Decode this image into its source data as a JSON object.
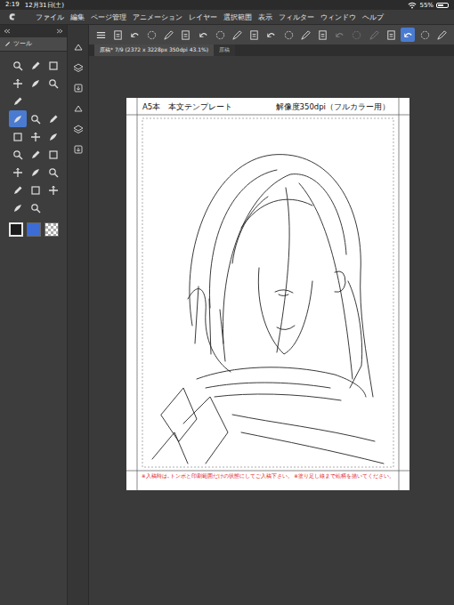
{
  "status_bar": {
    "time": "2:19",
    "date": "12月31日(土)",
    "battery": "55%",
    "battery_level": 0.55
  },
  "menu": [
    "ファイル",
    "編集",
    "ページ管理",
    "アニメーション",
    "レイヤー",
    "選択範囲",
    "表示",
    "フィルター",
    "ウィンドウ",
    "ヘルプ"
  ],
  "toolbar": {
    "buttons": [
      {
        "selected": false,
        "disabled": false
      },
      {
        "selected": false,
        "disabled": false
      },
      {
        "selected": false,
        "disabled": false
      },
      {
        "selected": false,
        "disabled": false
      },
      {
        "selected": false,
        "disabled": false
      },
      {
        "selected": false,
        "disabled": false
      },
      {
        "selected": false,
        "disabled": false
      },
      {
        "selected": false,
        "disabled": false
      },
      {
        "selected": false,
        "disabled": false
      },
      {
        "selected": false,
        "disabled": false
      },
      {
        "selected": false,
        "disabled": false
      },
      {
        "selected": false,
        "disabled": false
      },
      {
        "selected": false,
        "disabled": false
      },
      {
        "selected": false,
        "disabled": false
      },
      {
        "selected": false,
        "disabled": true
      },
      {
        "selected": false,
        "disabled": true
      },
      {
        "selected": false,
        "disabled": true
      },
      {
        "selected": false,
        "disabled": false
      },
      {
        "selected": true,
        "disabled": false
      },
      {
        "selected": false,
        "disabled": false
      },
      {
        "selected": false,
        "disabled": false
      }
    ]
  },
  "tool_panel": {
    "title": "ツール",
    "rows": [
      [
        {
          "selected": false
        },
        {
          "selected": false
        },
        {
          "selected": false
        }
      ],
      [
        {
          "selected": false
        },
        {
          "selected": false
        },
        {
          "selected": false
        }
      ],
      [
        {
          "selected": false
        }
      ],
      [
        {
          "selected": true
        },
        {
          "selected": false
        },
        {
          "selected": false
        }
      ],
      [
        {
          "selected": false
        },
        {
          "selected": false
        },
        {
          "selected": false
        }
      ],
      [
        {
          "selected": false
        },
        {
          "selected": false
        },
        {
          "selected": false
        }
      ],
      [
        {
          "selected": false
        },
        {
          "selected": false
        },
        {
          "selected": false
        }
      ],
      [
        {
          "selected": false
        },
        {
          "selected": false
        },
        {
          "selected": false
        }
      ],
      [
        {
          "selected": false
        },
        {
          "selected": false
        }
      ]
    ],
    "colors": [
      {
        "kind": "solid",
        "color": "#1b1b1b",
        "selected": true
      },
      {
        "kind": "solid",
        "color": "#3d6cd4",
        "selected": false
      },
      {
        "kind": "transparent",
        "selected": false
      }
    ]
  },
  "tabs": [
    {
      "label": "原稿* 7/9 (2372 x 3228px 350dpi 43.1%)",
      "selected": true
    },
    {
      "label": "原稿",
      "selected": false
    }
  ],
  "page": {
    "title": "A5本　本文テンプレート",
    "resolution": "解像度350dpi（フルカラー用）",
    "note": "※入稿時は､トンボと印刷範囲だけの状態にしてご入稿下さい。 ※塗り足し線まで絵柄を描いてください。"
  }
}
